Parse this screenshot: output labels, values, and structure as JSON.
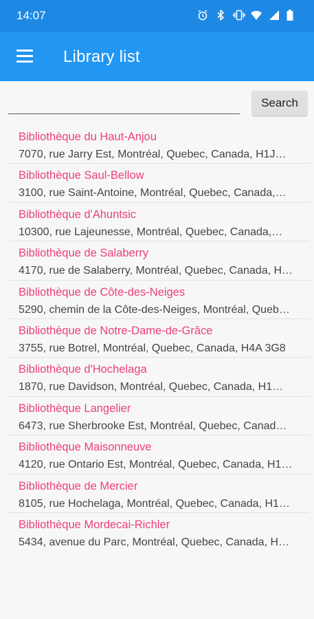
{
  "status_bar": {
    "time": "14:07",
    "icons": [
      "alarm-icon",
      "bluetooth-icon",
      "vibrate-icon",
      "wifi-icon",
      "signal-icon",
      "battery-icon"
    ]
  },
  "app_bar": {
    "title": "Library list",
    "menu_icon": "hamburger-menu-icon",
    "color": "#2196f3"
  },
  "search": {
    "value": "",
    "button_label": "Search"
  },
  "libraries": [
    {
      "name": "Bibliothèque du Haut-Anjou",
      "address": "7070, rue Jarry Est, Montréal, Quebec, Canada, H1J…"
    },
    {
      "name": "Bibliothèque Saul-Bellow",
      "address": "3100, rue Saint-Antoine, Montréal, Quebec, Canada,…"
    },
    {
      "name": "Bibliothèque d'Ahuntsic",
      "address": "10300, rue Lajeunesse, Montréal, Quebec, Canada,…"
    },
    {
      "name": "Bibliothèque de Salaberry",
      "address": "4170, rue de Salaberry, Montréal, Quebec, Canada, H…"
    },
    {
      "name": "Bibliothèque de Côte-des-Neiges",
      "address": "5290, chemin de la Côte-des-Neiges, Montréal, Queb…"
    },
    {
      "name": "Bibliothèque de Notre-Dame-de-Grâce",
      "address": "3755, rue Botrel, Montréal, Quebec, Canada, H4A 3G8"
    },
    {
      "name": "Bibliothèque d'Hochelaga",
      "address": "1870, rue Davidson, Montréal, Quebec, Canada, H1…"
    },
    {
      "name": "Bibliothèque Langelier",
      "address": "6473, rue Sherbrooke Est, Montréal, Quebec, Canad…"
    },
    {
      "name": "Bibliothèque Maisonneuve",
      "address": "4120, rue Ontario Est, Montréal, Quebec, Canada, H1…"
    },
    {
      "name": "Bibliothèque de Mercier",
      "address": "8105, rue Hochelaga, Montréal, Quebec, Canada, H1…"
    },
    {
      "name": "Bibliothèque Mordecai-Richler",
      "address": "5434, avenue du Parc, Montréal, Quebec, Canada, H…"
    }
  ],
  "colors": {
    "primary": "#2196f3",
    "primary_dark": "#1e88e5",
    "accent": "#ec407a",
    "background": "#f7f7f7"
  }
}
